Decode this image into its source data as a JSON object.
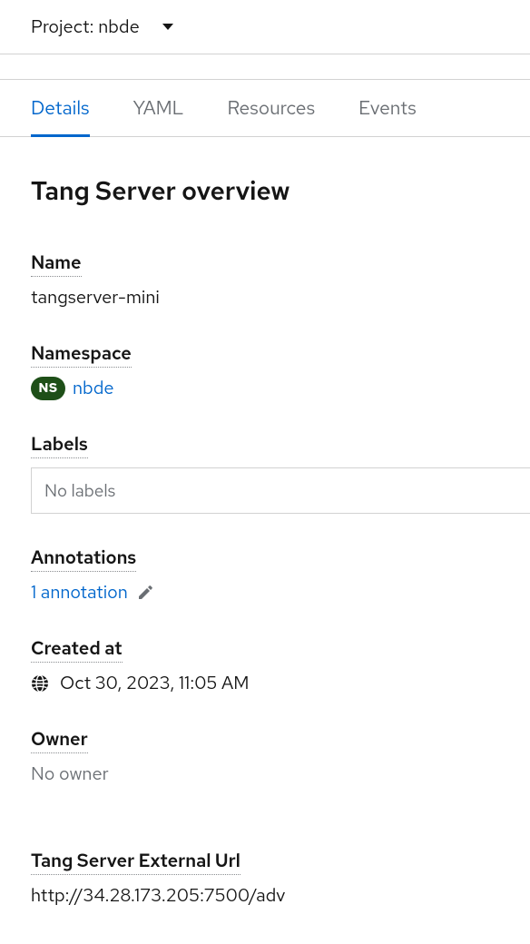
{
  "project": {
    "prefix": "Project:",
    "name": "nbde"
  },
  "tabs": {
    "details": "Details",
    "yaml": "YAML",
    "resources": "Resources",
    "events": "Events"
  },
  "page_title": "Tang Server overview",
  "labels": {
    "name": "Name",
    "namespace": "Namespace",
    "labels": "Labels",
    "annotations": "Annotations",
    "created_at": "Created at",
    "owner": "Owner",
    "external_url": "Tang Server External Url"
  },
  "values": {
    "name": "tangserver-mini",
    "ns_badge": "NS",
    "namespace": "nbde",
    "no_labels": "No labels",
    "annotation_link": "1 annotation",
    "created_at": "Oct 30, 2023, 11:05 AM",
    "owner": "No owner",
    "external_url": "http://34.28.173.205:7500/adv"
  }
}
